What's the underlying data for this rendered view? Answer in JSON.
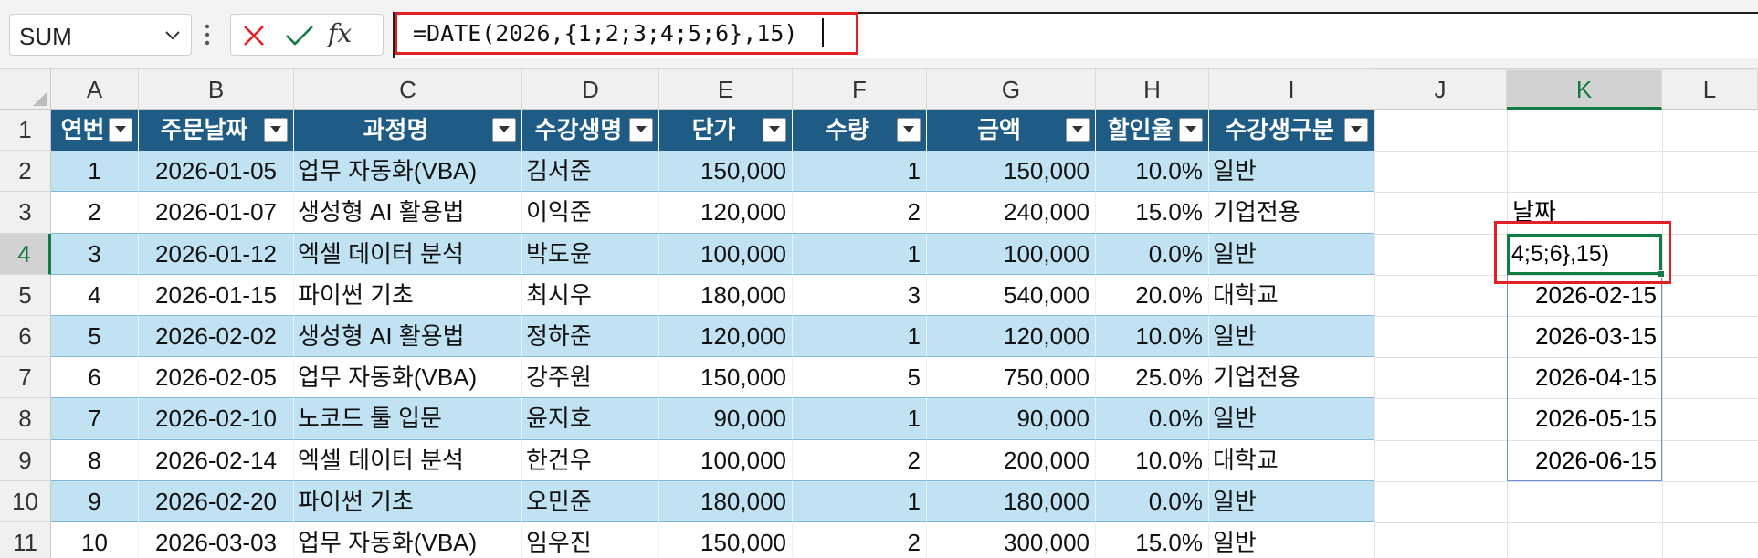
{
  "formula_bar": {
    "name_box": "SUM",
    "formula": "=DATE(2026,{1;2;3;4;5;6},15)",
    "fx_label": "fx"
  },
  "columns": [
    "A",
    "B",
    "C",
    "D",
    "E",
    "F",
    "G",
    "H",
    "I",
    "J",
    "K",
    "L"
  ],
  "rows": [
    "1",
    "2",
    "3",
    "4",
    "5",
    "6",
    "7",
    "8",
    "9",
    "10",
    "11"
  ],
  "table": {
    "headers": [
      "연번",
      "주문날짜",
      "과정명",
      "수강생명",
      "단가",
      "수량",
      "금액",
      "할인율",
      "수강생구분"
    ],
    "rows": [
      [
        "1",
        "2026-01-05",
        "업무 자동화(VBA)",
        "김서준",
        "150,000",
        "1",
        "150,000",
        "10.0%",
        "일반"
      ],
      [
        "2",
        "2026-01-07",
        "생성형 AI 활용법",
        "이익준",
        "120,000",
        "2",
        "240,000",
        "15.0%",
        "기업전용"
      ],
      [
        "3",
        "2026-01-12",
        "엑셀 데이터 분석",
        "박도윤",
        "100,000",
        "1",
        "100,000",
        "0.0%",
        "일반"
      ],
      [
        "4",
        "2026-01-15",
        "파이썬 기초",
        "최시우",
        "180,000",
        "3",
        "540,000",
        "20.0%",
        "대학교"
      ],
      [
        "5",
        "2026-02-02",
        "생성형 AI 활용법",
        "정하준",
        "120,000",
        "1",
        "120,000",
        "10.0%",
        "일반"
      ],
      [
        "6",
        "2026-02-05",
        "업무 자동화(VBA)",
        "강주원",
        "150,000",
        "5",
        "750,000",
        "25.0%",
        "기업전용"
      ],
      [
        "7",
        "2026-02-10",
        "노코드 툴 입문",
        "윤지호",
        "90,000",
        "1",
        "90,000",
        "0.0%",
        "일반"
      ],
      [
        "8",
        "2026-02-14",
        "엑셀 데이터 분석",
        "한건우",
        "100,000",
        "2",
        "200,000",
        "10.0%",
        "대학교"
      ],
      [
        "9",
        "2026-02-20",
        "파이썬 기초",
        "오민준",
        "180,000",
        "1",
        "180,000",
        "0.0%",
        "일반"
      ],
      [
        "10",
        "2026-03-03",
        "업무 자동화(VBA)",
        "임우진",
        "150,000",
        "2",
        "300,000",
        "15.0%",
        "일반"
      ]
    ]
  },
  "side": {
    "label": "날짜",
    "edit_cell": "4;5;6},15)",
    "dates": [
      "2026-02-15",
      "2026-03-15",
      "2026-04-15",
      "2026-05-15",
      "2026-06-15"
    ]
  },
  "colors": {
    "header_fill": "#1f5c85",
    "band_fill": "#c0e2f3",
    "highlight": "#e31e24",
    "excel_green": "#107c41"
  }
}
